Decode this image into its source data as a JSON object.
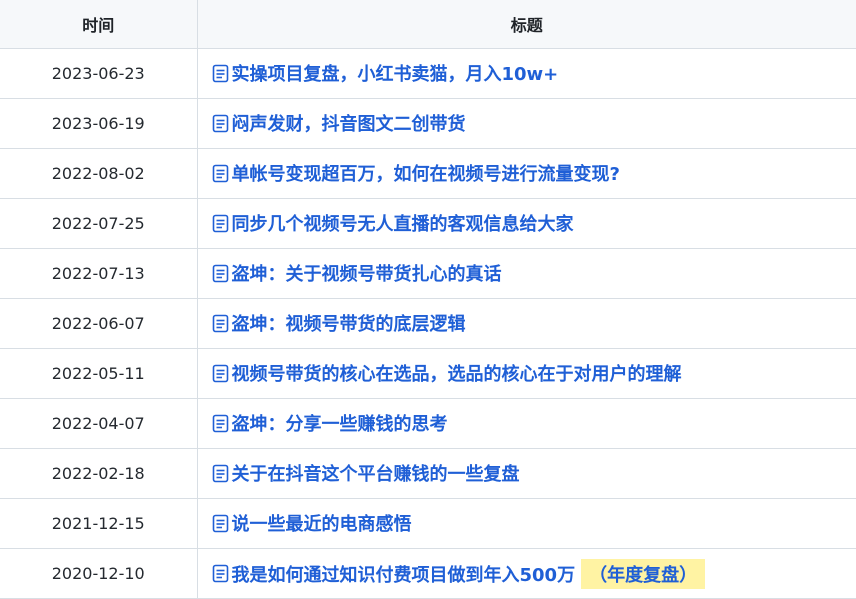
{
  "table": {
    "headers": {
      "date": "时间",
      "title": "标题"
    },
    "rows": [
      {
        "date": "2023-06-23",
        "title": "实操项目复盘，小红书卖猫，月入10w+",
        "badge": ""
      },
      {
        "date": "2023-06-19",
        "title": "闷声发财，抖音图文二创带货",
        "badge": ""
      },
      {
        "date": "2022-08-02",
        "title": "单帐号变现超百万，如何在视频号进行流量变现?",
        "badge": ""
      },
      {
        "date": "2022-07-25",
        "title": "同步几个视频号无人直播的客观信息给大家",
        "badge": ""
      },
      {
        "date": "2022-07-13",
        "title": "盗坤：关于视频号带货扎心的真话",
        "badge": ""
      },
      {
        "date": "2022-06-07",
        "title": "盗坤：视频号带货的底层逻辑",
        "badge": ""
      },
      {
        "date": "2022-05-11",
        "title": "视频号带货的核心在选品，选品的核心在于对用户的理解",
        "badge": ""
      },
      {
        "date": "2022-04-07",
        "title": "盗坤：分享一些赚钱的思考",
        "badge": ""
      },
      {
        "date": "2022-02-18",
        "title": "关于在抖音这个平台赚钱的一些复盘",
        "badge": ""
      },
      {
        "date": "2021-12-15",
        "title": "说一些最近的电商感悟",
        "badge": ""
      },
      {
        "date": "2020-12-10",
        "title": "我是如何通过知识付费项目做到年入500万",
        "badge": "（年度复盘）"
      }
    ]
  },
  "icons": {
    "row_icon": "document-icon"
  },
  "colors": {
    "link": "#1f5fd6",
    "highlight": "#fff3a3",
    "header_bg": "#f6f8fa",
    "border": "#d8dee4"
  }
}
